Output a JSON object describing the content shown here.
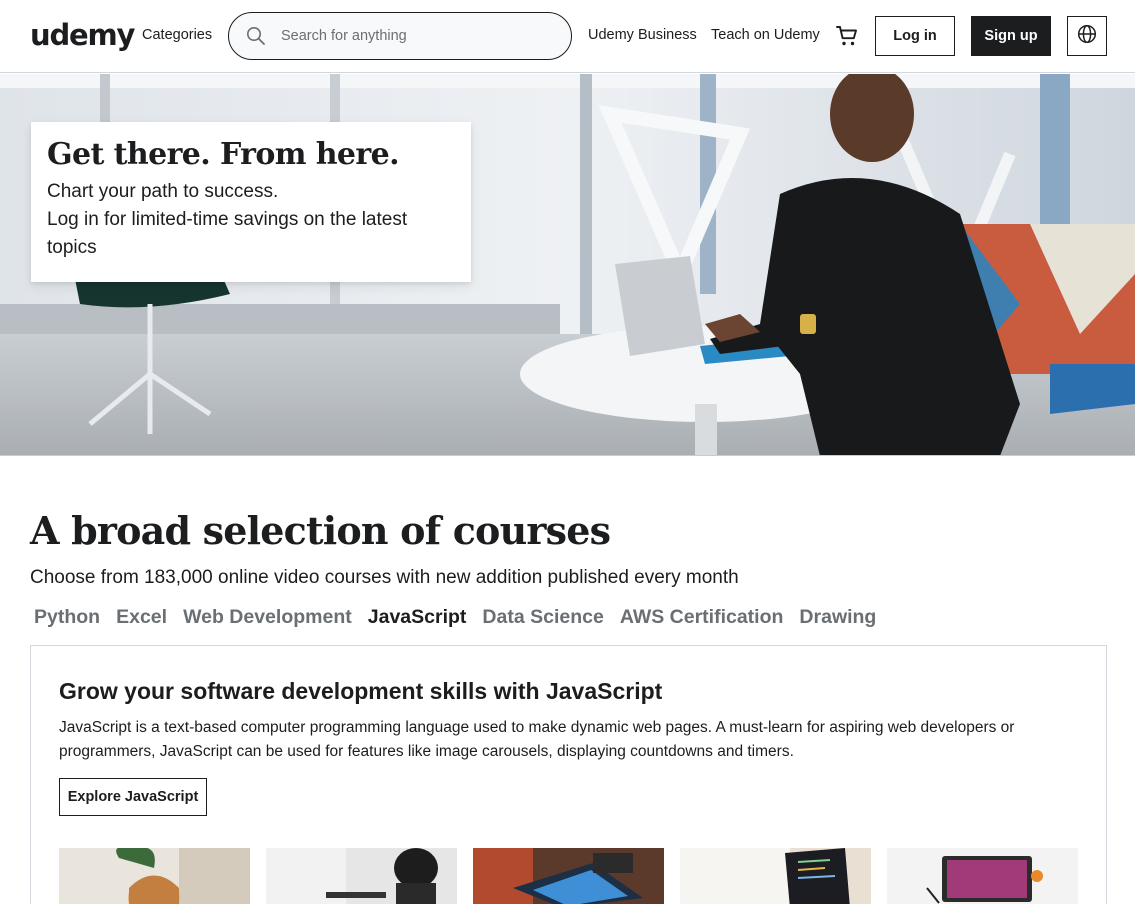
{
  "header": {
    "logo": "udemy",
    "categories_label": "Categories",
    "search_placeholder": "Search for anything",
    "business_link": "Udemy Business",
    "teach_link": "Teach on Udemy",
    "cart_icon": "shopping-cart-icon",
    "login_label": "Log in",
    "signup_label": "Sign up",
    "language_icon": "globe-icon"
  },
  "hero": {
    "title": "Get there. From here.",
    "line1": "Chart your path to success.",
    "line2": "Log in for limited-time savings on the latest topics"
  },
  "courses": {
    "title": "A broad selection of courses",
    "subtitle": "Choose from 183,000 online video courses with new addition published every month",
    "tabs": [
      "Python",
      "Excel",
      "Web Development",
      "JavaScript",
      "Data Science",
      "AWS Certification",
      "Drawing"
    ],
    "active_tab": "JavaScript",
    "panel": {
      "title": "Grow your software development skills with JavaScript",
      "description": "JavaScript is a text-based computer programming language used to make dynamic web pages. A must-learn for aspiring web developers or programmers, JavaScript can be used for features like image carousels, displaying countdowns and timers.",
      "explore_label": "Explore JavaScript"
    }
  },
  "colors": {
    "text": "#1c1d1f",
    "muted": "#6a6f73",
    "border": "#d1d7dc",
    "search_bg": "#f7f9fa"
  }
}
